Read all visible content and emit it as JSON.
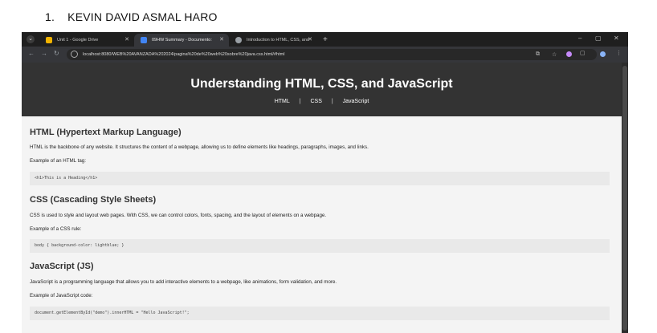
{
  "document": {
    "list_number": "1.",
    "author": "KEVIN DAVID ASMAL HARO"
  },
  "browser": {
    "tabs": [
      {
        "title": "Unit 1 - Google Drive",
        "close": "✕",
        "favicon_color": "#f4b400"
      },
      {
        "title": "09HW Summary - Documento:",
        "close": "✕",
        "favicon_color": "#4285f4"
      },
      {
        "title": "Introduction to HTML, CSS, and",
        "close": "✕",
        "favicon_color": "#9aa0a6"
      }
    ],
    "new_tab": "+",
    "window_controls": {
      "minimize": "–",
      "maximize": "▢",
      "close": "✕"
    },
    "nav": {
      "back": "←",
      "forward": "→",
      "reload": "↻"
    },
    "url": "localhost:8080/WEB%20AVANZADA%202024/pagina%20de%20web%20sobre%20java.css.html/#html"
  },
  "page": {
    "title": "Understanding HTML, CSS, and JavaScript",
    "nav": {
      "html": "HTML",
      "css": "CSS",
      "js": "JavaScript",
      "separator": "|"
    },
    "sections": [
      {
        "title": "HTML (Hypertext Markup Language)",
        "text": "HTML is the backbone of any website. It structures the content of a webpage, allowing us to define elements like headings, paragraphs, images, and links.",
        "example_label": "Example of an HTML tag:",
        "code": "<h1>This is a Heading</h1>"
      },
      {
        "title": "CSS (Cascading Style Sheets)",
        "text": "CSS is used to style and layout web pages. With CSS, we can control colors, fonts, spacing, and the layout of elements on a webpage.",
        "example_label": "Example of a CSS rule:",
        "code": "body { background-color: lightblue; }"
      },
      {
        "title": "JavaScript (JS)",
        "text": "JavaScript is a programming language that allows you to add interactive elements to a webpage, like animations, form validation, and more.",
        "example_label": "Example of JavaScript code:",
        "code": "document.getElementById(\"demo\").innerHTML = \"Hello JavaScript!\";"
      }
    ]
  }
}
